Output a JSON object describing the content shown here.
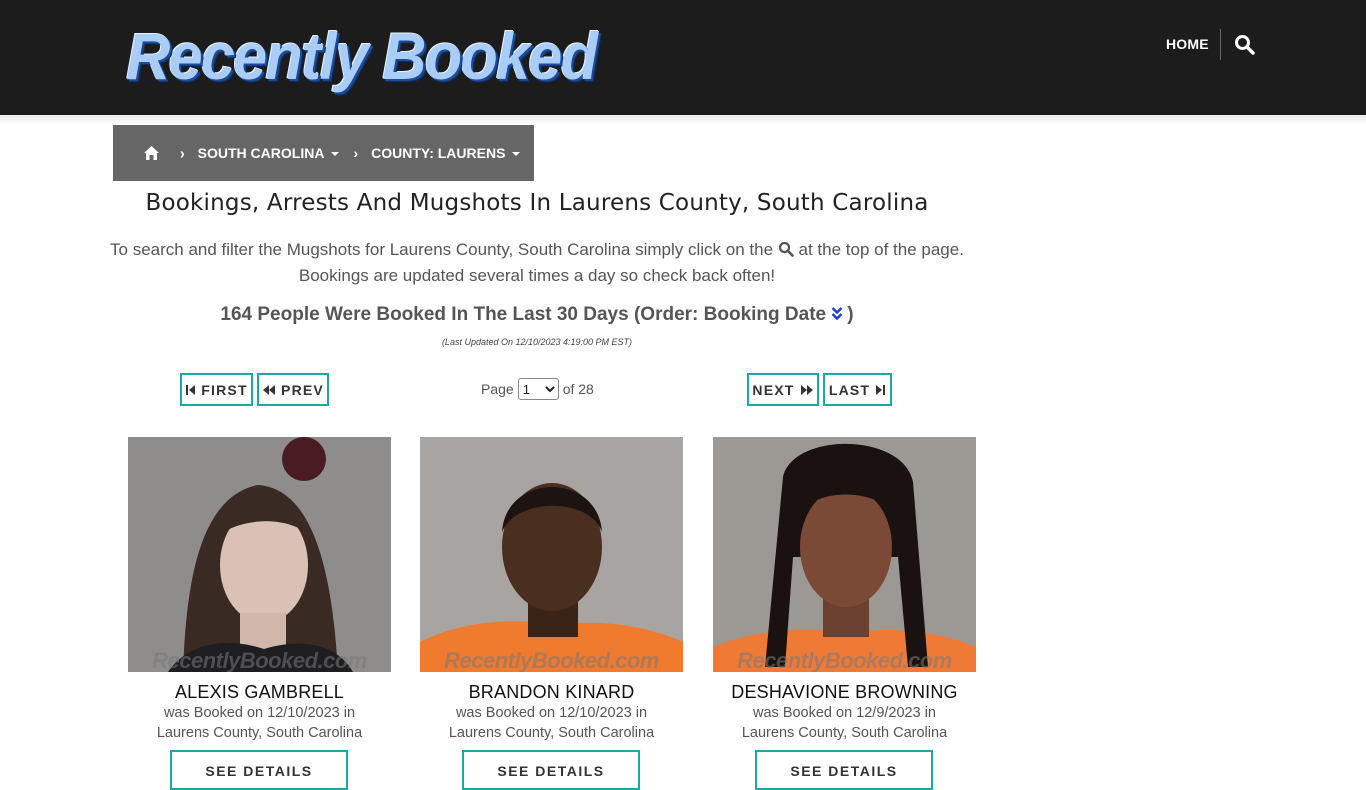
{
  "header": {
    "logo_text": "Recently Booked",
    "nav_home": "HOME",
    "search_icon": "search-icon"
  },
  "breadcrumb": {
    "home_icon": "home-icon",
    "state": "SOUTH CAROLINA",
    "county": "COUNTY: LAURENS"
  },
  "page": {
    "title": "Bookings, Arrests And Mugshots In Laurens County, South Carolina",
    "desc_part1": "To search and filter the Mugshots for Laurens County, South Carolina simply click on the",
    "desc_part2": "at the top of the page.",
    "desc_line2": "Bookings are updated several times a day so check back often!",
    "count_text": "164 People Were Booked In The Last 30 Days (Order: Booking Date",
    "count_close": ")",
    "last_updated": "(Last Updated On 12/10/2023 4:19:00 PM EST)"
  },
  "pagination": {
    "first": "FIRST",
    "prev": "PREV",
    "next": "NEXT",
    "last": "LAST",
    "page_label": "Page",
    "current_page": "1",
    "of_label": "of 28"
  },
  "bookings": [
    {
      "name": "ALEXIS GAMBRELL",
      "booked_line": "was Booked on 12/10/2023 in",
      "location": "Laurens County, South Carolina",
      "details_label": "SEE DETAILS"
    },
    {
      "name": "BRANDON KINARD",
      "booked_line": "was Booked on 12/10/2023 in",
      "location": "Laurens County, South Carolina",
      "details_label": "SEE DETAILS"
    },
    {
      "name": "DESHAVIONE BROWNING",
      "booked_line": "was Booked on 12/9/2023 in",
      "location": "Laurens County, South Carolina",
      "details_label": "SEE DETAILS"
    }
  ],
  "watermark": "RecentlyBooked.com",
  "colors": {
    "header_bg": "#1c1c1c",
    "breadcrumb_bg": "#666666",
    "accent": "#1aa9a4",
    "link_blue": "#1a3fd6"
  }
}
